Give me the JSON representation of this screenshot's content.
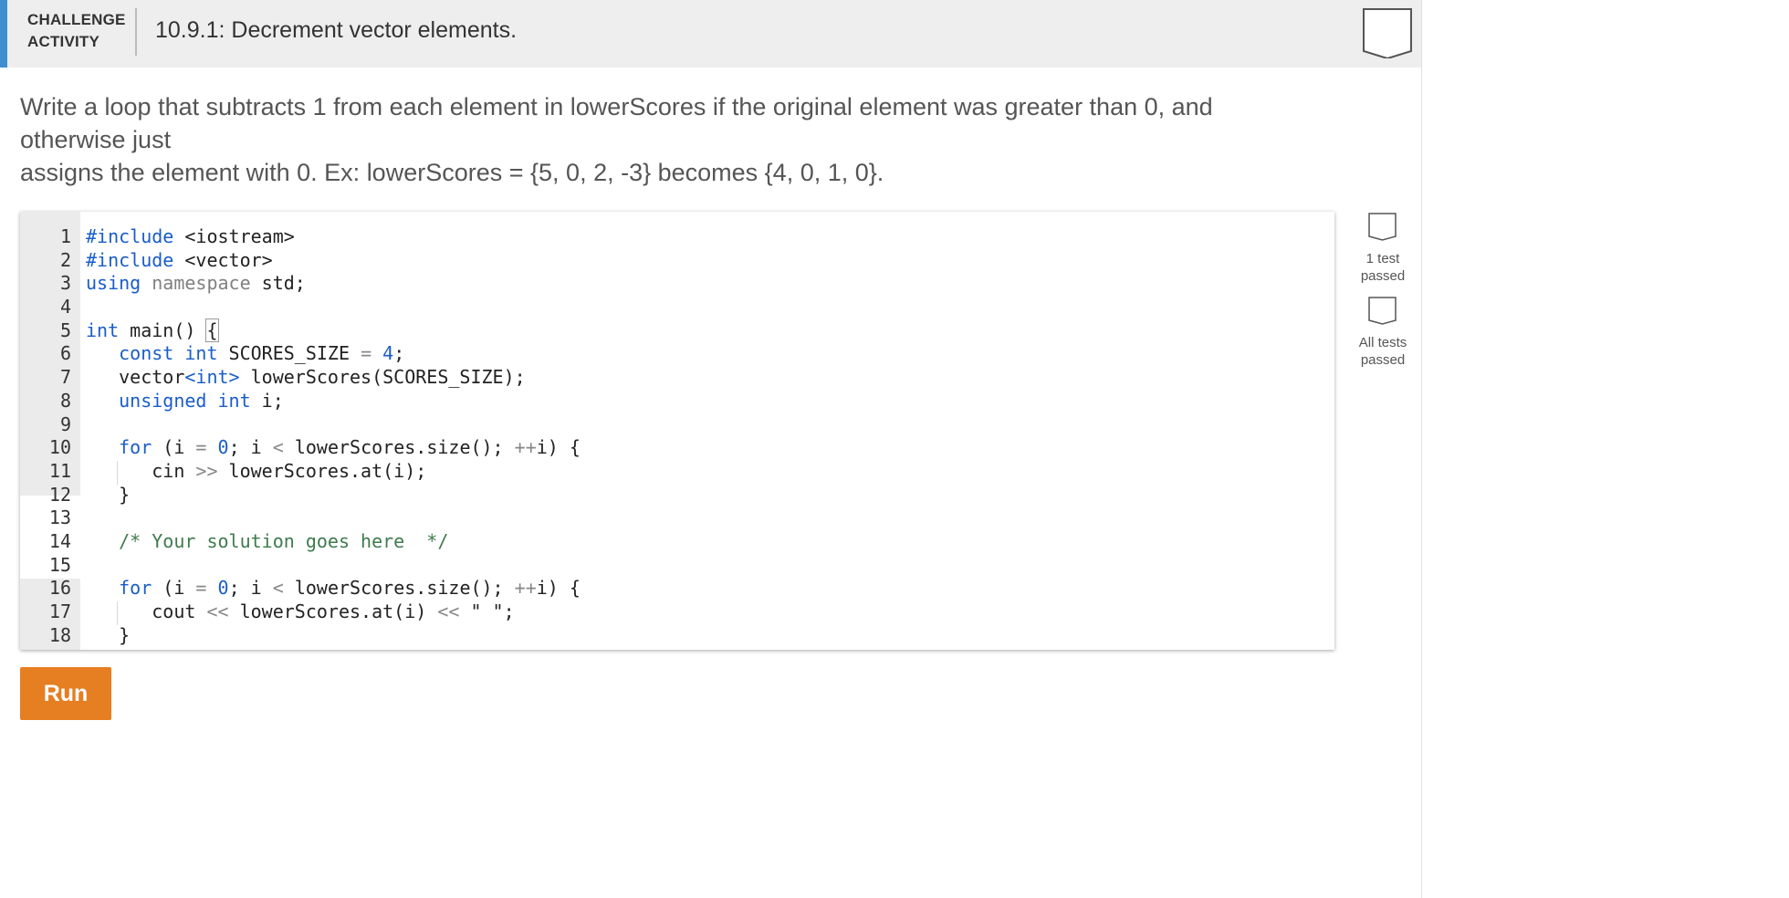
{
  "header": {
    "label_line1": "CHALLENGE",
    "label_line2": "ACTIVITY",
    "title": "10.9.1: Decrement vector elements.",
    "badge_icon": "completion-badge-icon"
  },
  "prompt": {
    "line1": "Write a loop that subtracts 1 from each element in lowerScores if the original element was greater than 0, and otherwise just",
    "line2": "assigns the element with 0. Ex: lowerScores = {5, 0, 2, -3} becomes {4, 0, 1, 0}."
  },
  "editor": {
    "line_numbers": [
      "1",
      "2",
      "3",
      "4",
      "5",
      "6",
      "7",
      "8",
      "9",
      "10",
      "11",
      "12",
      "13",
      "14",
      "15",
      "16",
      "17",
      "18"
    ],
    "lines": {
      "l1_kw": "#include",
      "l1_rest": " <iostream>",
      "l2_kw": "#include",
      "l2_rest": " <vector>",
      "l3_kw": "using",
      "l3_ns": "namespace",
      "l3_rest": " std;",
      "l5_ty": "int",
      "l5_rest": " main() ",
      "l5_brace": "{",
      "l6_kw": "const",
      "l6_ty": "int",
      "l6_name": " SCORES_SIZE ",
      "l6_op": "=",
      "l6_num": "4",
      "l6_end": ";",
      "l7_pre": "vector",
      "l7_tpl": "<int>",
      "l7_rest": " lowerScores(SCORES_SIZE);",
      "l8_kw": "unsigned",
      "l8_ty": "int",
      "l8_rest": " i;",
      "l10_kw": "for",
      "l10_a": " (i ",
      "l10_op1": "=",
      "l10_num": "0",
      "l10_b": "; i ",
      "l10_op2": "<",
      "l10_c": " lowerScores.size(); ",
      "l10_op3": "++",
      "l10_d": "i) {",
      "l11_a": "cin ",
      "l11_op": ">>",
      "l11_b": " lowerScores.at(i);",
      "l12": "}",
      "l14_comment": "/* Your solution goes here  */",
      "l16_kw": "for",
      "l16_a": " (i ",
      "l16_op1": "=",
      "l16_num": "0",
      "l16_b": "; i ",
      "l16_op2": "<",
      "l16_c": " lowerScores.size(); ",
      "l16_op3": "++",
      "l16_d": "i) {",
      "l17_a": "cout ",
      "l17_op1": "<<",
      "l17_b": " lowerScores.at(i) ",
      "l17_op2": "<<",
      "l17_str": " \" \"",
      "l17_end": ";",
      "l18": "}"
    }
  },
  "run_button": {
    "label": "Run"
  },
  "progress": {
    "test1_label_line1": "1 test",
    "test1_label_line2": "passed",
    "test2_label_line1": "All tests",
    "test2_label_line2": "passed",
    "check_icon": "unchecked-box-icon"
  }
}
